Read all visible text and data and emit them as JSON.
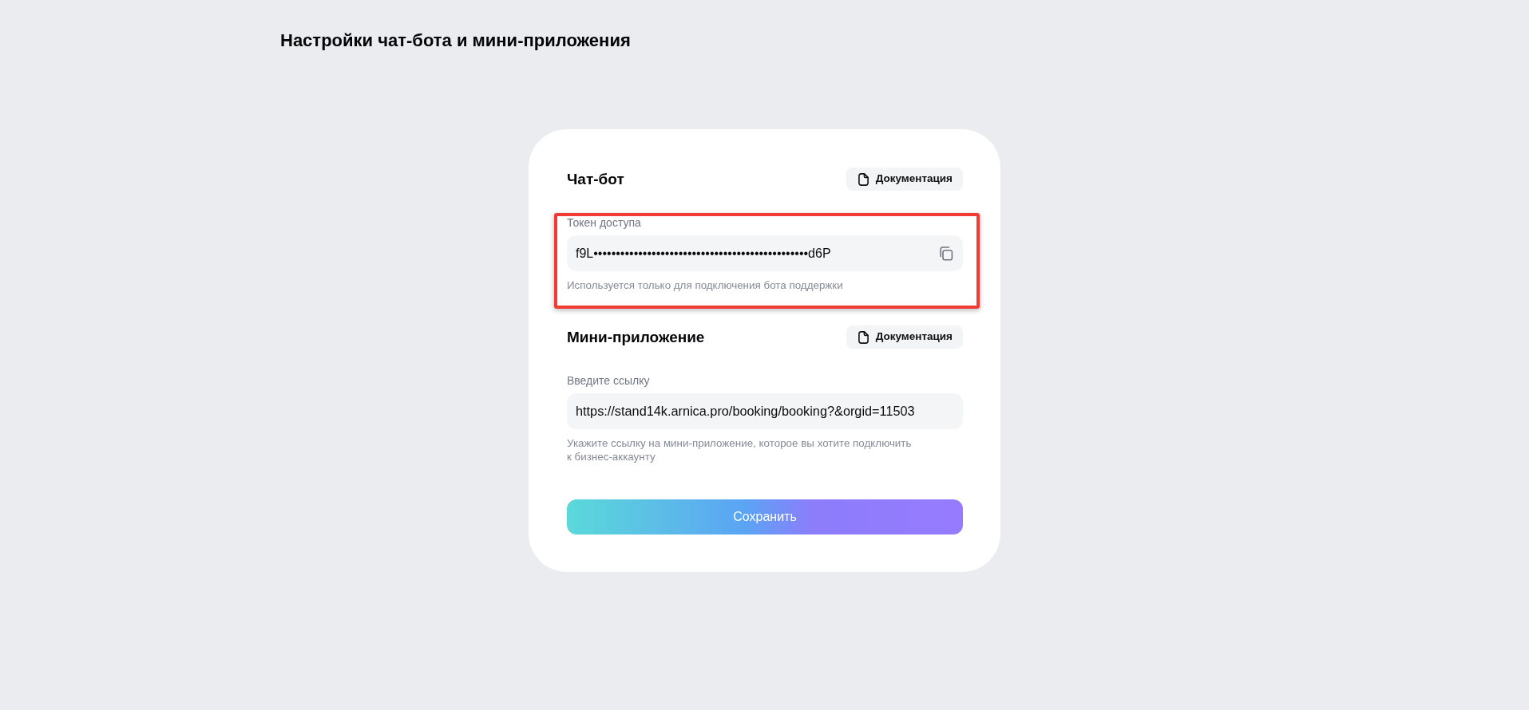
{
  "page": {
    "title": "Настройки чат-бота и мини-приложения"
  },
  "chat_bot": {
    "heading": "Чат-бот",
    "docs_button": "Документация",
    "token_field": {
      "label": "Токен доступа",
      "value": "f9L••••••••••••••••••••••••••••••••••••••••••••••••d6P",
      "hint": "Используется только для подключения бота поддержки",
      "highlighted": true
    }
  },
  "mini_app": {
    "heading": "Мини-приложение",
    "docs_button": "Документация",
    "url_field": {
      "label": "Введите ссылку",
      "value": "https://stand14k.arnica.pro/booking/booking?&orgid=11503",
      "hint": "Укажите ссылку на мини-приложение, которое вы хотите подключить к бизнес-аккаунту"
    }
  },
  "save_button": "Сохранить"
}
